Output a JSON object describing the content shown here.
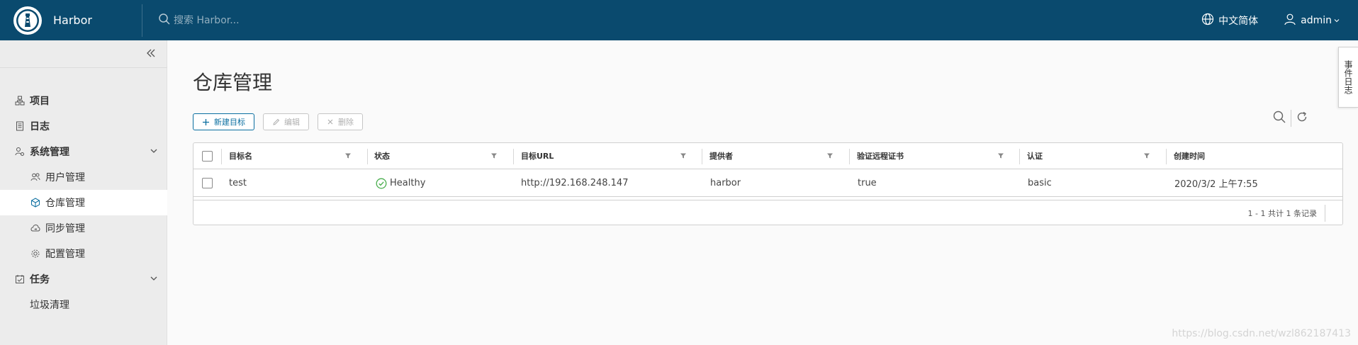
{
  "header": {
    "brand": "Harbor",
    "search_placeholder": "搜索 Harbor...",
    "language": "中文简体",
    "user": "admin"
  },
  "sidebar": {
    "items": [
      {
        "label": "项目",
        "icon": "projects-icon"
      },
      {
        "label": "日志",
        "icon": "logs-icon"
      },
      {
        "label": "系统管理",
        "icon": "admin-icon"
      },
      {
        "label": "用户管理",
        "icon": "users-icon"
      },
      {
        "label": "仓库管理",
        "icon": "registry-icon"
      },
      {
        "label": "同步管理",
        "icon": "replication-icon"
      },
      {
        "label": "配置管理",
        "icon": "config-icon"
      },
      {
        "label": "任务",
        "icon": "tasks-icon"
      },
      {
        "label": "垃圾清理",
        "icon": ""
      }
    ]
  },
  "main": {
    "title": "仓库管理",
    "toolbar": {
      "new": "新建目标",
      "edit": "编辑",
      "delete": "删除"
    },
    "table": {
      "columns": [
        "目标名",
        "状态",
        "目标URL",
        "提供者",
        "验证远程证书",
        "认证",
        "创建时间"
      ],
      "rows": [
        {
          "name": "test",
          "status": "Healthy",
          "url": "http://192.168.248.147",
          "provider": "harbor",
          "verify": "true",
          "auth": "basic",
          "created": "2020/3/2 上午7:55"
        }
      ],
      "footer": "1 - 1 共计 1 条记录"
    }
  },
  "side_tab": "事件日志",
  "watermark": "https://blog.csdn.net/wzl862187413",
  "colors": {
    "header_bg": "#0a4a6e",
    "accent": "#0a6ea0",
    "healthy": "#4caf50"
  }
}
